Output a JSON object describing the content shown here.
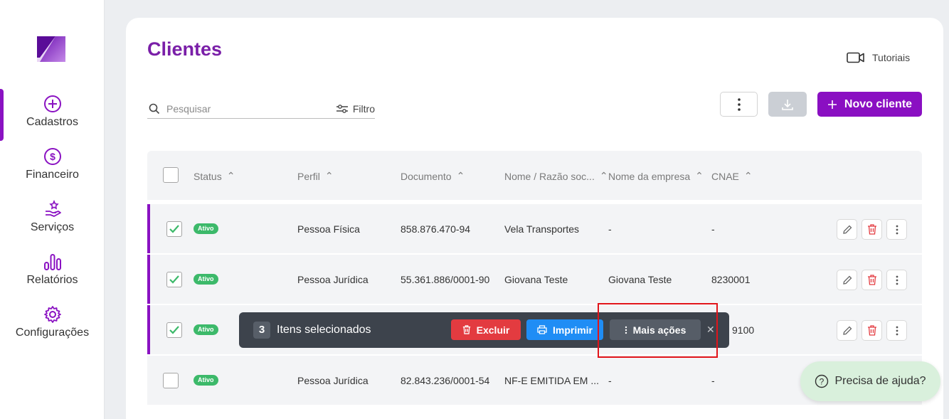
{
  "sidebar": {
    "items": [
      {
        "label": "Cadastros",
        "icon": "plus-circle-icon",
        "active": true
      },
      {
        "label": "Financeiro",
        "icon": "dollar-circle-icon"
      },
      {
        "label": "Serviços",
        "icon": "hand-star-icon"
      },
      {
        "label": "Relatórios",
        "icon": "bar-chart-icon"
      },
      {
        "label": "Configurações",
        "icon": "gear-icon"
      }
    ]
  },
  "header": {
    "title": "Clientes",
    "tutorials_label": "Tutoriais"
  },
  "toolbar": {
    "search_placeholder": "Pesquisar",
    "filter_label": "Filtro",
    "new_client_label": "Novo cliente"
  },
  "table": {
    "columns": [
      "Status",
      "Perfil",
      "Documento",
      "Nome / Razão soc...",
      "Nome da empresa",
      "CNAE"
    ],
    "rows": [
      {
        "checked": true,
        "status": "Ativo",
        "perfil": "Pessoa Física",
        "documento": "858.876.470-94",
        "nome": "Vela Transportes",
        "empresa": "-",
        "cnae": "-"
      },
      {
        "checked": true,
        "status": "Ativo",
        "perfil": "Pessoa Jurídica",
        "documento": "55.361.886/0001-90",
        "nome": "Giovana Teste",
        "empresa": "Giovana Teste",
        "cnae": "8230001"
      },
      {
        "checked": true,
        "status": "Ativo",
        "perfil": "",
        "documento": "",
        "nome": "",
        "empresa": "",
        "cnae": "9100"
      },
      {
        "checked": false,
        "status": "Ativo",
        "perfil": "Pessoa Jurídica",
        "documento": "82.843.236/0001-54",
        "nome": "NF-E EMITIDA EM ...",
        "empresa": "-",
        "cnae": "-"
      }
    ]
  },
  "selection_bar": {
    "count": "3",
    "text": "Itens selecionados",
    "delete_label": "Excluir",
    "print_label": "Imprimir",
    "more_label": "Mais ações",
    "close_glyph": "✕"
  },
  "help": {
    "label": "Precisa de ajuda?"
  },
  "colors": {
    "brand": "#8a0fc2",
    "active_badge": "#3cb96a",
    "delete": "#e33b40",
    "print": "#1f8df5",
    "highlight": "#e1141a"
  }
}
